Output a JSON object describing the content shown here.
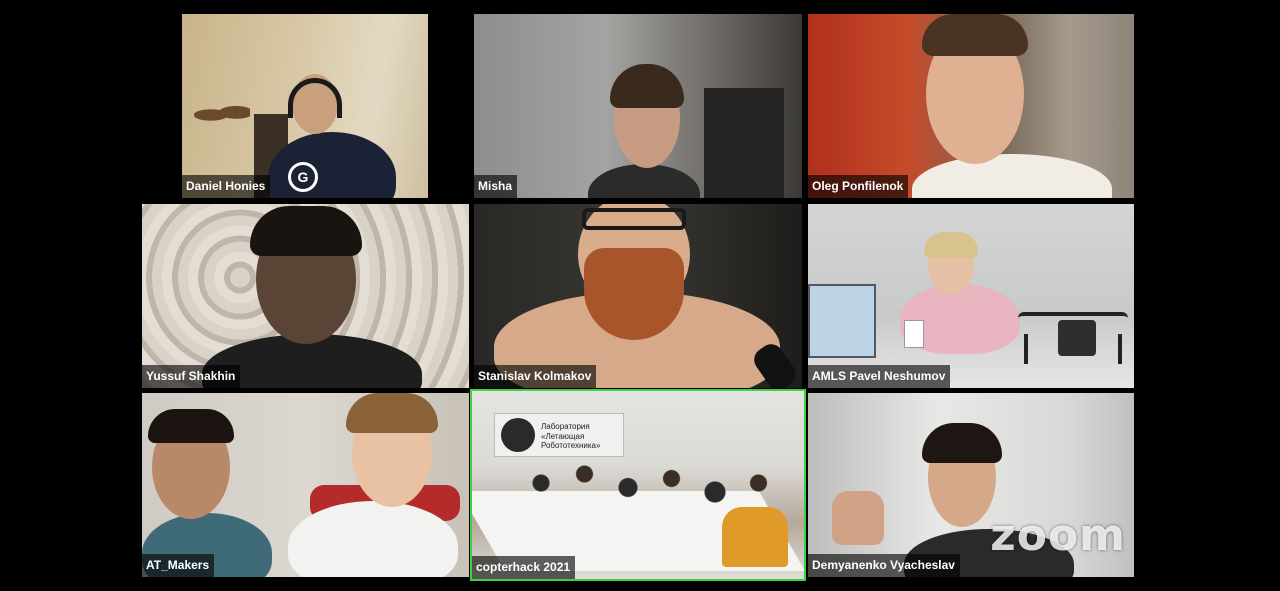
{
  "meeting": {
    "app": "zoom",
    "watermark": "zoom",
    "active_speaker_color": "#3fd13f"
  },
  "participants": [
    {
      "name": "Daniel Honies"
    },
    {
      "name": "Misha"
    },
    {
      "name": "Oleg Ponfilenok"
    },
    {
      "name": "Yussuf Shakhin"
    },
    {
      "name": "Stanislav Kolmakov"
    },
    {
      "name": "AMLS Pavel Neshumov"
    },
    {
      "name": "AT_Makers"
    },
    {
      "name": "copterhack 2021",
      "active": true
    },
    {
      "name": "Demyanenko Vyacheslav"
    }
  ],
  "tile_content": {
    "shirt_logo": "G",
    "poster_line1": "Лаборатория",
    "poster_line2": "«Летающая Робототехника»"
  }
}
